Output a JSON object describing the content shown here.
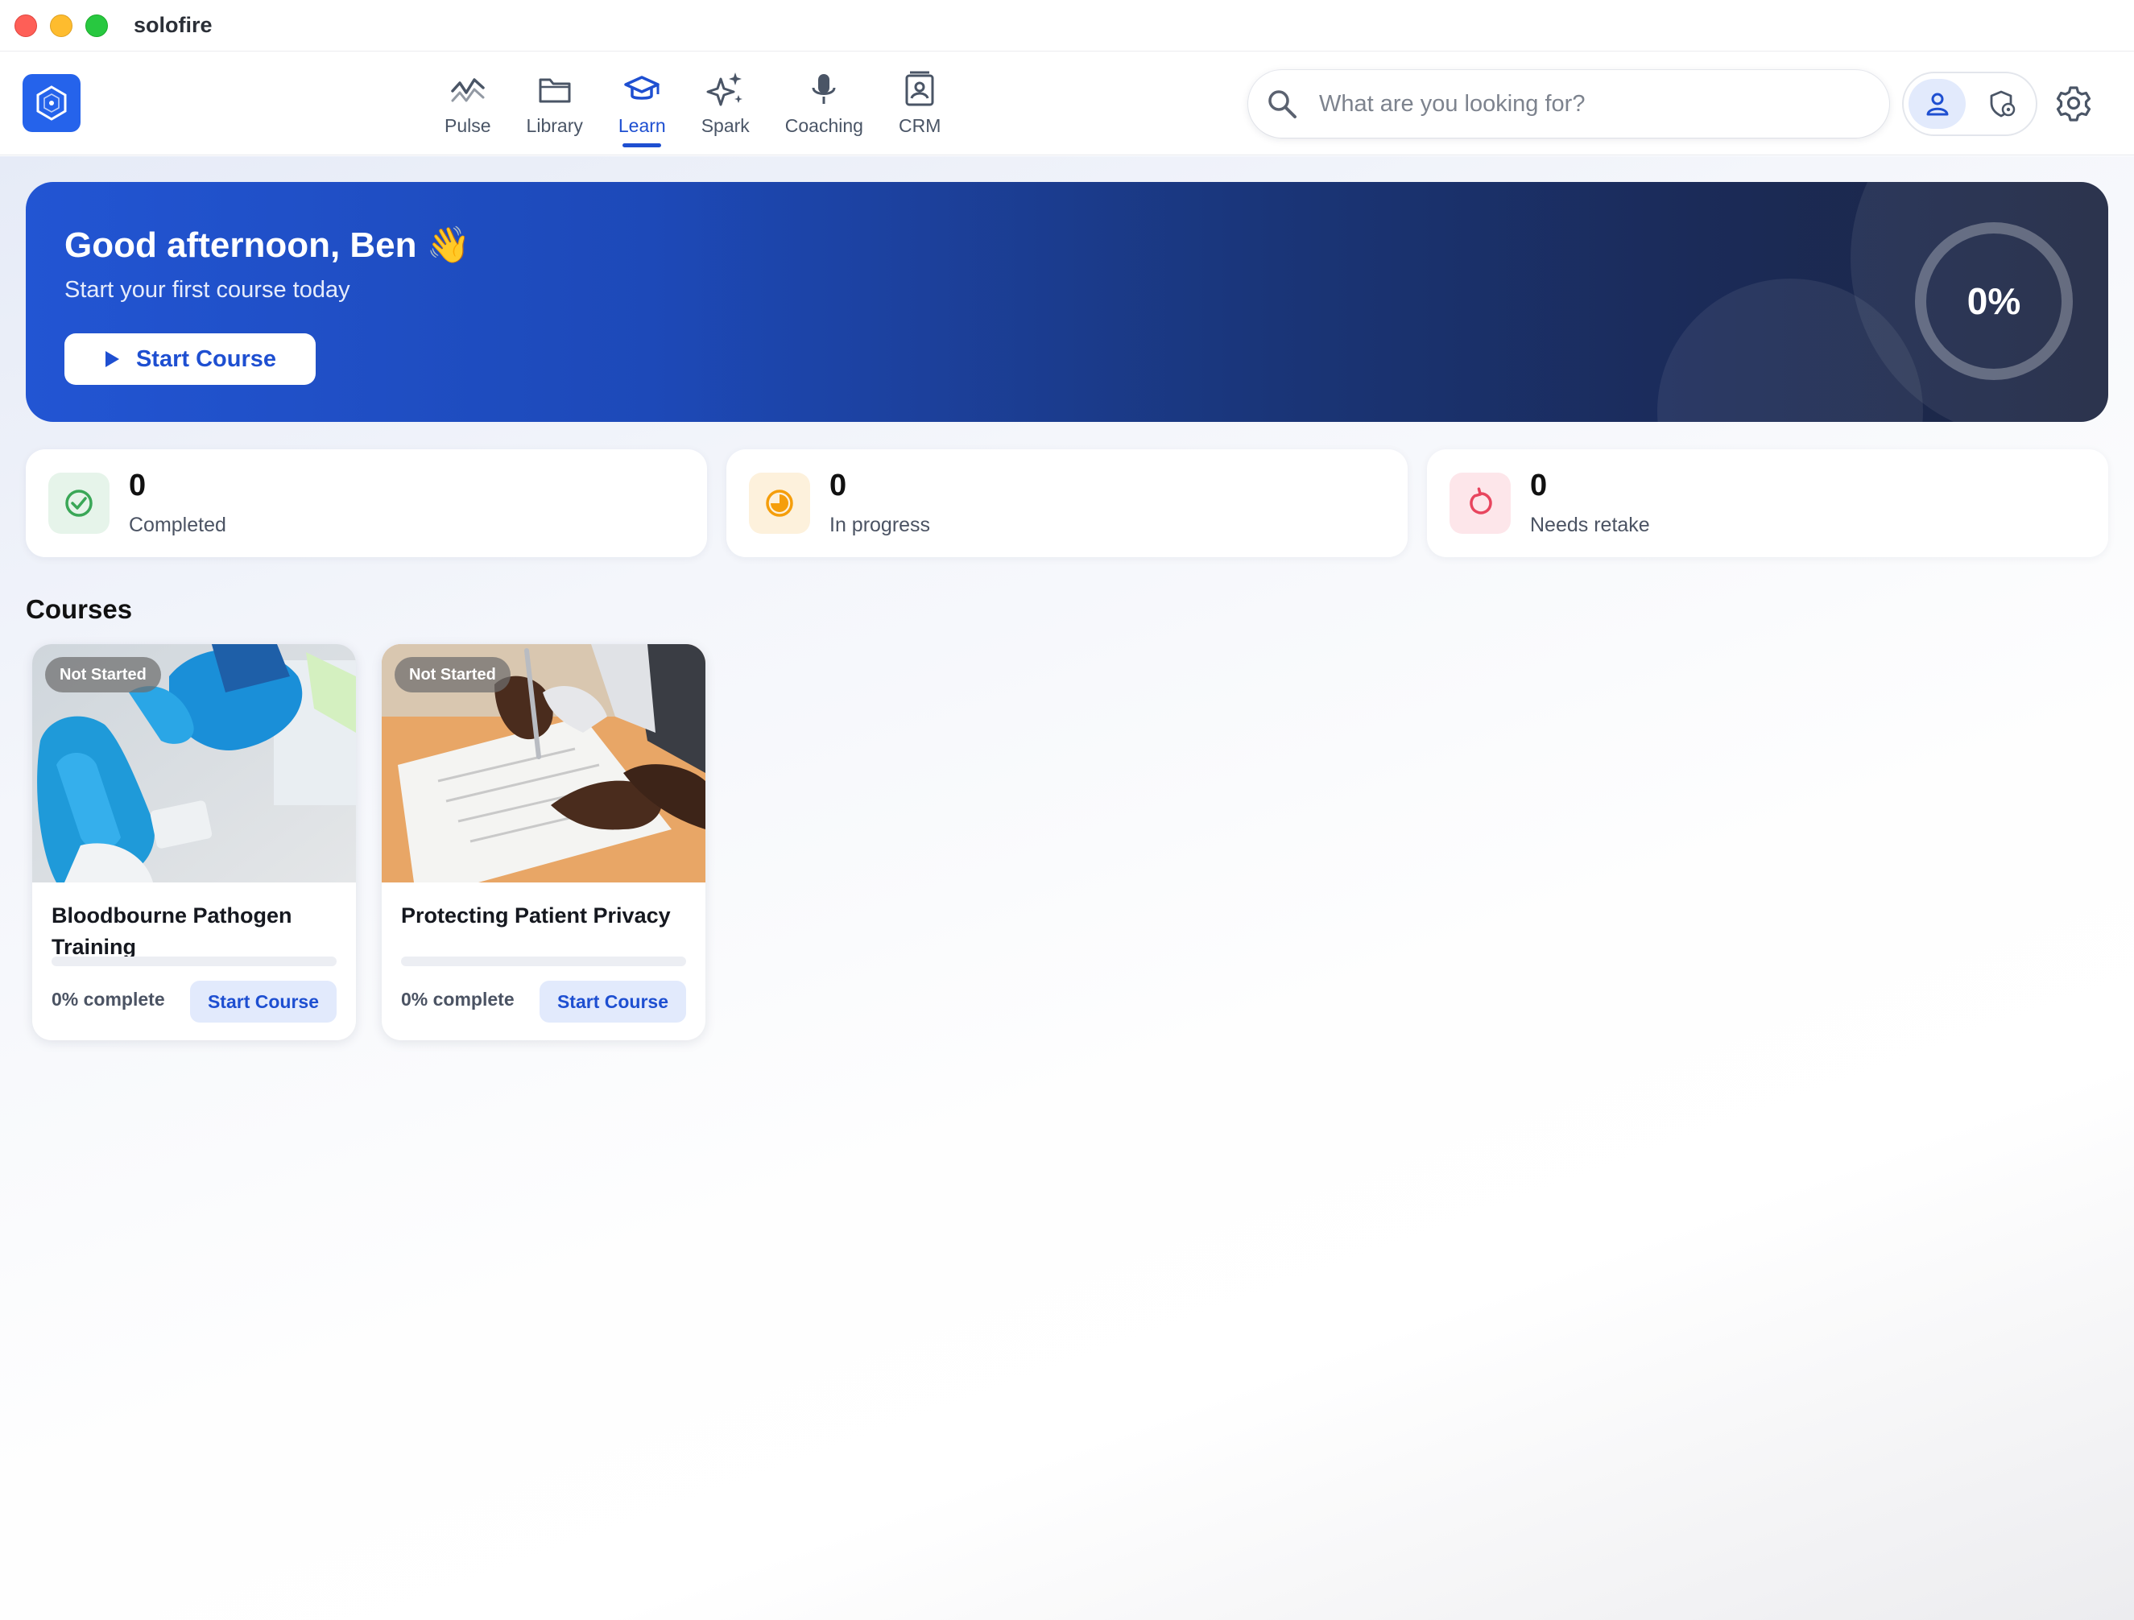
{
  "window": {
    "app_name": "solofire"
  },
  "nav": {
    "items": [
      {
        "label": "Pulse",
        "icon": "pulse-icon",
        "active": false
      },
      {
        "label": "Library",
        "icon": "folder-icon",
        "active": false
      },
      {
        "label": "Learn",
        "icon": "graduation-cap-icon",
        "active": true
      },
      {
        "label": "Spark",
        "icon": "sparkles-icon",
        "active": false
      },
      {
        "label": "Coaching",
        "icon": "microphone-icon",
        "active": false
      },
      {
        "label": "CRM",
        "icon": "contact-book-icon",
        "active": false
      }
    ]
  },
  "search": {
    "placeholder": "What are you looking for?",
    "value": ""
  },
  "hero": {
    "greeting": "Good afternoon, Ben 👋",
    "subtitle": "Start your first course today",
    "button_label": "Start Course",
    "progress_label": "0%",
    "progress_value": 0
  },
  "stats": [
    {
      "value": "0",
      "label": "Completed",
      "icon": "check-circle-icon",
      "color": "#3aa757",
      "bg": "#e6f4ea"
    },
    {
      "value": "0",
      "label": "In progress",
      "icon": "half-clock-icon",
      "color": "#f59e0b",
      "bg": "#fdf1dc"
    },
    {
      "value": "0",
      "label": "Needs retake",
      "icon": "retry-icon",
      "color": "#e8455e",
      "bg": "#fde6ea"
    }
  ],
  "courses_section": {
    "title": "Courses"
  },
  "courses": [
    {
      "badge": "Not Started",
      "title": "Bloodbourne Pathogen Training",
      "progress": 0,
      "progress_label": "0% complete",
      "button_label": "Start Course",
      "image": "gloved-hands-cleaning-photo"
    },
    {
      "badge": "Not Started",
      "title": "Protecting Patient Privacy",
      "progress": 0,
      "progress_label": "0% complete",
      "button_label": "Start Course",
      "image": "hand-signing-document-photo"
    }
  ],
  "colors": {
    "accent": "#1e4fd1",
    "brand": "#2563eb"
  }
}
